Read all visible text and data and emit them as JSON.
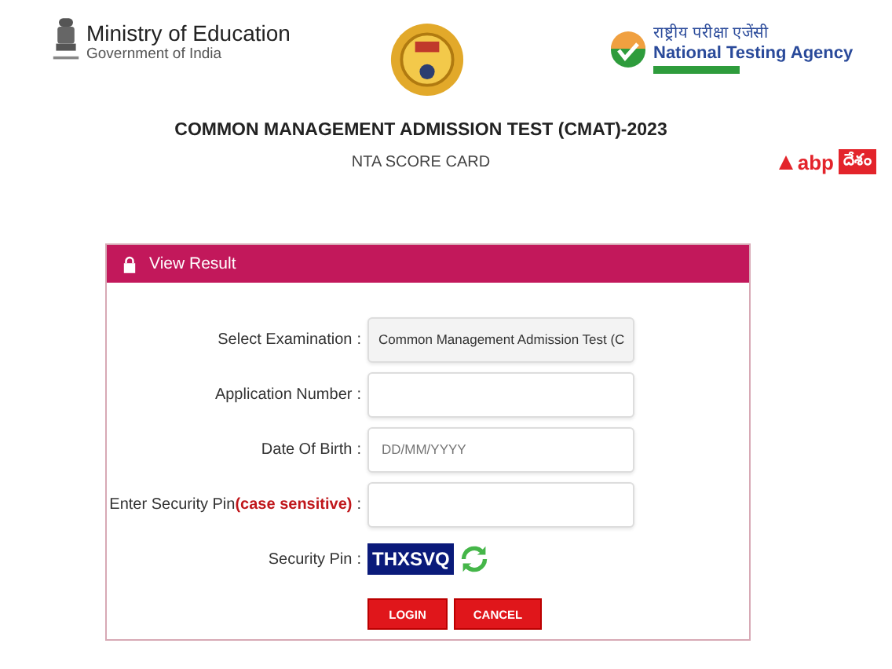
{
  "header": {
    "ministry": {
      "title": "Ministry of Education",
      "subtitle": "Government of India"
    },
    "agency": {
      "hindi": "राष्ट्रीय परीक्षा एजेंसी",
      "name": "National Testing Agency"
    },
    "exam_title": "COMMON MANAGEMENT ADMISSION TEST (CMAT)-2023",
    "subtitle": "NTA SCORE CARD",
    "brand": {
      "name": "abp",
      "badge": "దేశం"
    }
  },
  "panel": {
    "title": "View Result",
    "rows": [
      {
        "kind": "select",
        "label": "Select Examination",
        "colon": ":",
        "value": "Common Management Admission Test (C"
      },
      {
        "kind": "text",
        "label": "Application Number",
        "colon": ":"
      },
      {
        "kind": "text",
        "label": "Date Of Birth",
        "colon": ":",
        "placeholder": "DD/MM/YYYY"
      },
      {
        "kind": "text",
        "label": "Enter Security Pin",
        "note": "(case sensitive)",
        "colon": ":"
      },
      {
        "kind": "captcha",
        "label": "Security Pin",
        "colon": ":",
        "value": "THXSVQ"
      }
    ],
    "buttons": [
      "LOGIN",
      "CANCEL"
    ]
  }
}
